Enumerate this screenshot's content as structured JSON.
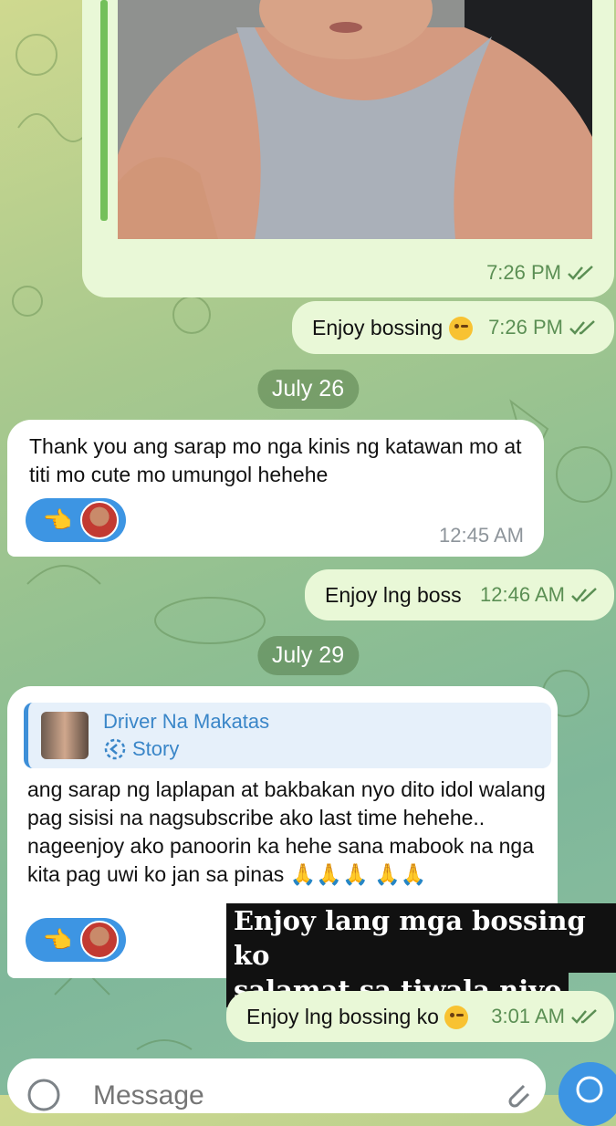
{
  "photo_message": {
    "time": "7:26 PM"
  },
  "messages": [
    {
      "text": "Enjoy bossing",
      "emoji": "😉",
      "time": "7:26 PM"
    },
    {
      "date": "July 26"
    },
    {
      "text": "Thank you ang sarap mo nga kinis ng katawan mo at titi mo cute mo umungol hehehe",
      "time": "12:45 AM",
      "reaction": "👈"
    },
    {
      "text": "Enjoy lng boss",
      "time": "12:46 AM"
    },
    {
      "date": "July 29"
    },
    {
      "reply_name": "Driver Na Makatas",
      "reply_type": "Story",
      "text": "ang sarap ng laplapan at bakbakan nyo dito idol walang pag sisisi na nagsubscribe ako last time hehehe.. nageenjoy ako panoorin ka hehe sana mabook na nga kita pag uwi ko jan sa pinas 🙏🙏🙏 🙏🙏",
      "reaction": "👈"
    },
    {
      "text": "Enjoy lng bossing ko",
      "emoji": "😉",
      "time": "3:01 AM"
    }
  ],
  "overlay_caption": {
    "line1": "Enjoy lang mga bossing ko",
    "line2": "salamat sa tiwala niyo"
  },
  "composer": {
    "placeholder": "Message"
  },
  "colors": {
    "outgoing": "#e9f8d7",
    "incoming": "#ffffff",
    "accent": "#3d95e3",
    "tick": "#5b8f54"
  }
}
